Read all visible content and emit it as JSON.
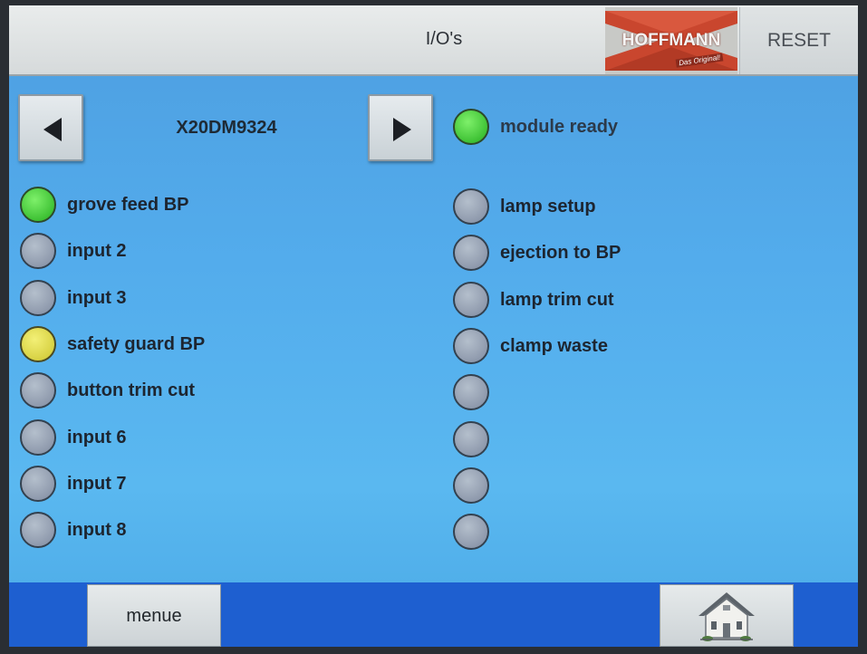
{
  "header": {
    "title": "I/O's",
    "logo_text": "HOFFMANN",
    "logo_sub": "Das Original!",
    "reset_label": "RESET"
  },
  "module": {
    "name": "X20DM9324",
    "status_label": "module ready",
    "status": "on"
  },
  "left_io": [
    {
      "label": "grove feed BP",
      "state": "green"
    },
    {
      "label": "input 2",
      "state": "off"
    },
    {
      "label": "input 3",
      "state": "off"
    },
    {
      "label": "safety guard BP",
      "state": "yellow"
    },
    {
      "label": "button trim cut",
      "state": "off"
    },
    {
      "label": "input 6",
      "state": "off"
    },
    {
      "label": "input 7",
      "state": "off"
    },
    {
      "label": "input 8",
      "state": "off"
    }
  ],
  "right_io": [
    {
      "label": "lamp setup",
      "state": "off"
    },
    {
      "label": "ejection to BP",
      "state": "off"
    },
    {
      "label": "lamp trim cut",
      "state": "off"
    },
    {
      "label": "clamp waste",
      "state": "off"
    },
    {
      "label": "",
      "state": "off"
    },
    {
      "label": "",
      "state": "off"
    },
    {
      "label": "",
      "state": "off"
    },
    {
      "label": "",
      "state": "off"
    }
  ],
  "footer": {
    "menu_label": "menue",
    "home_icon": "home-icon"
  },
  "colors": {
    "background": "#53acec",
    "footer": "#1e5fd0",
    "led_on": "#3fc235",
    "led_warn": "#d8d244",
    "led_off": "#8f9aad"
  }
}
